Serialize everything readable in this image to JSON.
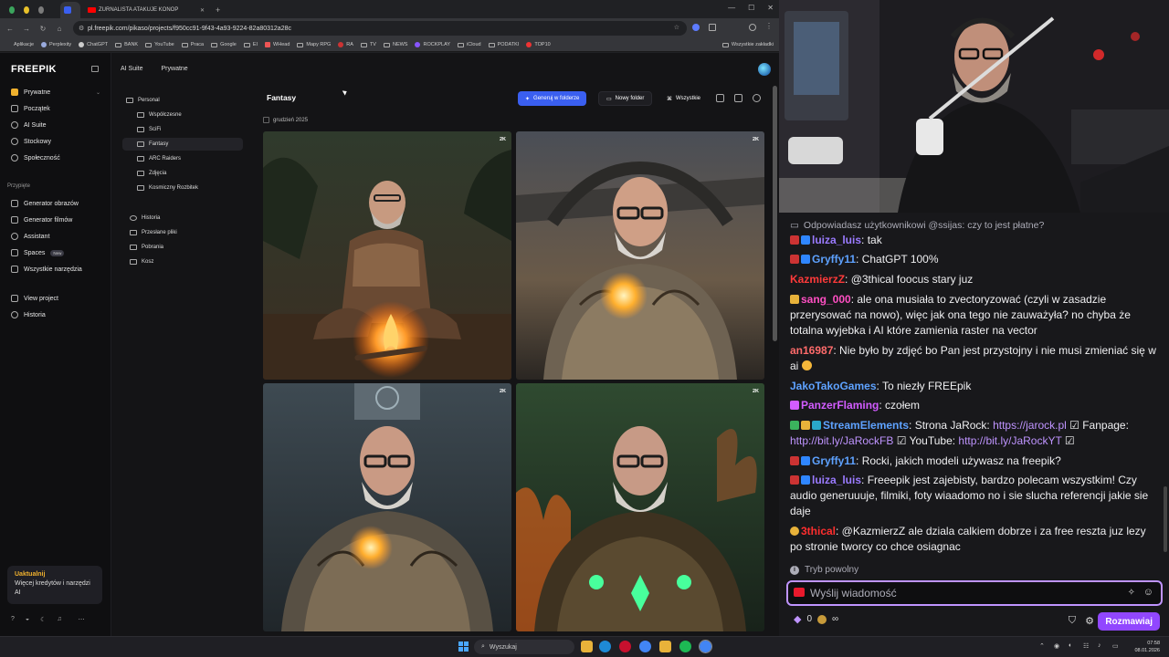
{
  "browser": {
    "tabs": [
      {
        "label": ""
      },
      {
        "label": ""
      },
      {
        "label": ""
      },
      {
        "label": ""
      },
      {
        "label": "ZURNALISTA ATAKUJE KONOP"
      }
    ],
    "url": "pl.freepik.com/pikaso/projects/f950cc91-9f43-4a93-9224-82a80312a28c",
    "bookmarks": [
      "Aplikacje",
      "Perplexity",
      "ChatGPT",
      "BANK",
      "YouTube",
      "Praca",
      "Google",
      "EI",
      "WHead",
      "Mapy RPG",
      "RA",
      "TV",
      "NEWS",
      "ROCKPLAY",
      "iCloud",
      "PODATKI",
      "TOP10"
    ],
    "bookmarks_right": "Wszystkie zakładki"
  },
  "freepik": {
    "logo": "FREEPIK",
    "workspace": "Prywatne",
    "nav": [
      "Początek",
      "AI Suite",
      "Stockowy",
      "Społeczność"
    ],
    "pinned_header": "Przypięte",
    "pinned": [
      "Generator obrazów",
      "Generator filmów",
      "Assistant",
      "Spaces",
      "Wszystkie narzędzia"
    ],
    "spaces_badge": "New",
    "extra": [
      "View project",
      "Historia"
    ],
    "upgrade_title": "Uaktualnij",
    "upgrade_text": "Więcej kredytów i narzędzi AI",
    "breadcrumb": [
      "AI Suite",
      "Prywatne"
    ],
    "tree": {
      "root": "Personal",
      "folders": [
        "Współczesne",
        "SciFi",
        "Fantasy",
        "ARC Raiders",
        "Zdjęcia",
        "Kosmiczny Rozbitek"
      ],
      "other": [
        "Historia",
        "Przesłane pliki",
        "Pobrania",
        "Kosz"
      ]
    },
    "content": {
      "title": "Fantasy",
      "generate_btn": "Generuj w folderze",
      "new_folder_btn": "Nowy folder",
      "filter_btn": "Wszystkie",
      "date": "grudzień 2025",
      "tile_tag": "2K"
    }
  },
  "chat": {
    "reply": "Odpowiadasz użytkownikowi @ssijas: czy to jest płatne?",
    "messages": [
      {
        "user": "luiza_luis",
        "color": "#9b7bff",
        "text": ": tak"
      },
      {
        "user": "Gryffy11",
        "color": "#5ea2ff",
        "text": ": ChatGPT 100%"
      },
      {
        "user": "KazmierzZ",
        "color": "#ff3a3a",
        "text": ": @3thical foocus stary juz"
      },
      {
        "user": "sang_000",
        "color": "#ff4fc3",
        "text": ": ale ona musiała to zvectoryzować (czyli w zasadzie przerysować na nowo), więc jak ona tego nie zauważyła? no chyba że totalna wyjebka i AI które zamienia raster na vector"
      },
      {
        "user": "an16987",
        "color": "#ff6b6b",
        "text": ": Nie było by zdjęć bo Pan jest przystojny i nie musi zmieniać się w ai"
      },
      {
        "user": "JakoTakoGames",
        "color": "#5ea2ff",
        "text": ": To niezły FREEpik"
      },
      {
        "user": "PanzerFlaming",
        "color": "#d25cff",
        "text": ": czołem"
      },
      {
        "user": "StreamElements",
        "color": "#5ea2ff",
        "text": ": Strona JaRock: ",
        "link1": "https://jarock.pl",
        "mid": " ☑ Fanpage: ",
        "link2": "http://bit.ly/JaRockFB",
        "mid2": " ☑ YouTube: ",
        "link3": "http://bit.ly/JaRockYT",
        "end": " ☑"
      },
      {
        "user": "Gryffy11",
        "color": "#5ea2ff",
        "text": ": Rocki, jakich modeli używasz na freepik?"
      },
      {
        "user": "luiza_luis",
        "color": "#9b7bff",
        "text": ": Freeepik jest zajebisty, bardzo polecam wszystkim! Czy audio generuuuje, filmiki, foty wiaadomo no i sie slucha referencji jakie sie daje"
      },
      {
        "user": "3thical",
        "color": "#ff2e2e",
        "text": ": @KazmierzZ ale dziala calkiem dobrze i za free reszta juz lezy po stronie tworcy co chce osiagnac"
      }
    ],
    "slow_mode": "Tryb powolny",
    "placeholder": "Wyślij wiadomość",
    "points": "0",
    "send": "Rozmawiaj"
  },
  "taskbar": {
    "search": "Wyszukaj",
    "time": "07:58",
    "date": "08.01.2026"
  }
}
